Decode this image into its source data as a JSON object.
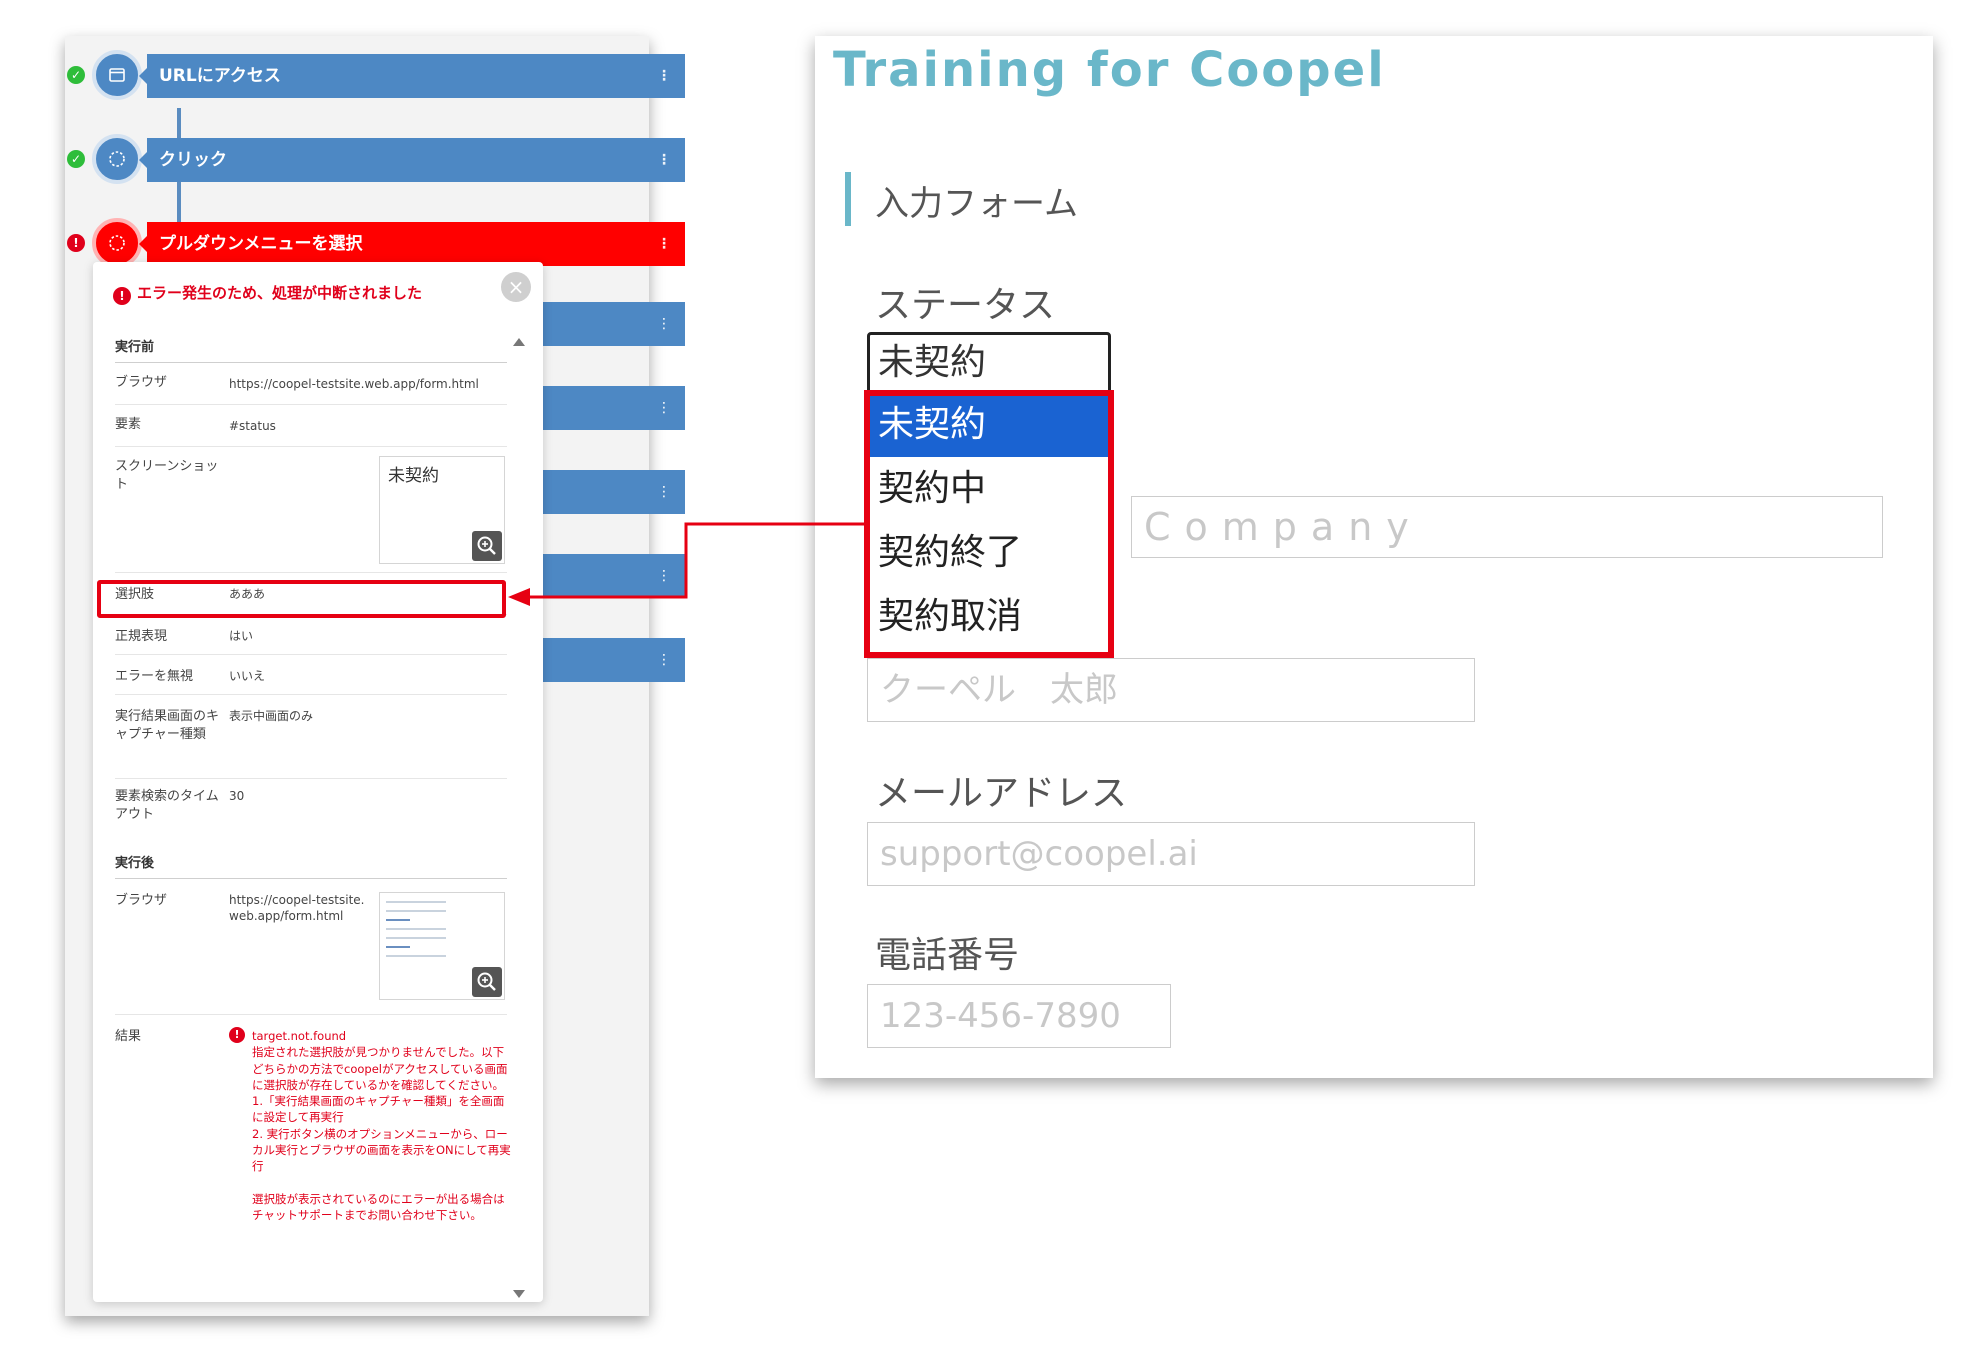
{
  "workflow": {
    "steps": [
      {
        "label": "URLにアクセス",
        "status": "ok"
      },
      {
        "label": "クリック",
        "status": "ok"
      },
      {
        "label": "プルダウンメニューを選択",
        "status": "error"
      }
    ],
    "kebab": "⋮",
    "status_ok_glyph": "✓",
    "status_err_glyph": "!"
  },
  "detail": {
    "error_title": "エラー発生のため、処理が中断されました",
    "close_glyph": "×",
    "before_heading": "実行前",
    "before_rows": {
      "browser_label": "ブラウザ",
      "browser_value": "https://coopel-testsite.web.app/form.html",
      "element_label": "要素",
      "element_value": "#status",
      "screenshot_label": "スクリーンショット",
      "screenshot_text": "未契約",
      "choice_label": "選択肢",
      "choice_value": "あああ",
      "regex_label": "正規表現",
      "regex_value": "はい",
      "ignore_label": "エラーを無視",
      "ignore_value": "いいえ",
      "capture_label": "実行結果画面のキャプチャー種類",
      "capture_value": "表示中画面のみ",
      "timeout_label": "要素検索のタイムアウト",
      "timeout_value": "30"
    },
    "after_heading": "実行後",
    "after_rows": {
      "browser_label": "ブラウザ",
      "browser_value": "https://coopel-testsite.web.app/form.html",
      "result_label": "結果",
      "result_text": "target.not.found\n指定された選択肢が見つかりませんでした。以下どちらかの方法でcoopelがアクセスしている画面に選択肢が存在しているかを確認してください。\n1.「実行結果画面のキャプチャー種類」を全画面に設定して再実行\n2. 実行ボタン横のオプションメニューから、ローカル実行とブラウザの画面を表示をONにして再実行\n\n選択肢が表示されているのにエラーが出る場合はチャットサポートまでお問い合わせ下さい。"
    }
  },
  "form": {
    "app_title": "Training for Coopel",
    "section_title": "入力フォーム",
    "status_label": "ステータス",
    "status_selected": "未契約",
    "status_options": [
      "未契約",
      "契約中",
      "契約終了",
      "契約取消"
    ],
    "company_placeholder": "Company",
    "name_placeholder": "クーペル　太郎",
    "email_label": "メールアドレス",
    "email_placeholder": "support@coopel.ai",
    "phone_label": "電話番号",
    "phone_placeholder": "123-456-7890"
  },
  "colors": {
    "step_blue": "#4d88c4",
    "step_error": "#ff0000",
    "error_text": "#e0001b",
    "title_teal": "#6ab7c9",
    "selected_option": "#1a63d2",
    "highlight_red": "#e60012"
  }
}
